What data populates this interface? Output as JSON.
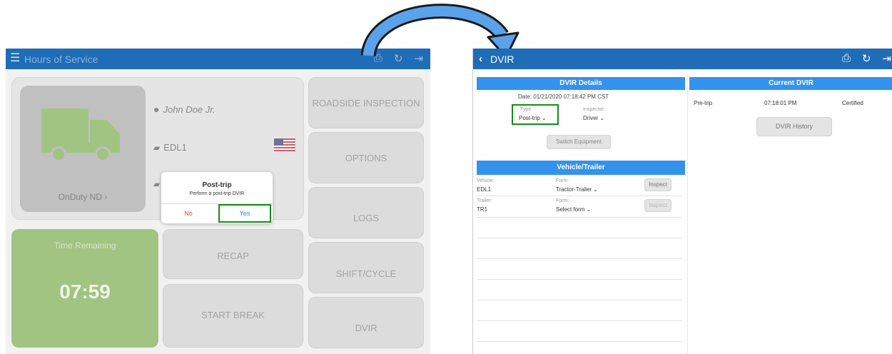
{
  "left_screen": {
    "header": {
      "title": "Hours of Service",
      "menu_icon": "hamburger-icon",
      "icons": [
        "print-icon",
        "refresh-icon",
        "logout-icon"
      ]
    },
    "driver": {
      "name": "John Doe Jr.",
      "vehicle": "EDL1",
      "duty_status": "OnDuty ND ›"
    },
    "tiles": {
      "roadside": "ROADSIDE INSPECTION",
      "options": "OPTIONS",
      "logs": "LOGS",
      "shift": "SHIFT/CYCLE",
      "dvir": "DVIR",
      "recap": "RECAP",
      "start_break": "START BREAK"
    },
    "time": {
      "label": "Time Remaining",
      "value": "07:59"
    },
    "dialog": {
      "title": "Post-trip",
      "message": "Perform a post-trip DVIR",
      "no": "No",
      "yes": "Yes"
    }
  },
  "right_screen": {
    "header": {
      "back": "‹",
      "title": "DVIR",
      "icons": [
        "print-icon",
        "refresh-icon",
        "logout-icon"
      ]
    },
    "details": {
      "section": "DVIR Details",
      "date": "Date: 01/21/2020 07:18:42 PM CST",
      "type_label": "Type:",
      "type_value": "Post-trip ⌄",
      "inspector_label": "Inspector:",
      "inspector_value": "Driver ⌄",
      "switch_equipment": "Switch Equipment"
    },
    "vehicle_trailer": {
      "section": "Vehicle/Trailer",
      "rows": [
        {
          "label": "Vehicle:",
          "value": "EDL1",
          "form_label": "Form:",
          "form_value": "Tractor-Trailer ⌄",
          "button": "Inspect"
        },
        {
          "label": "Trailer:",
          "value": "TR1",
          "form_label": "Form:",
          "form_value": "Select form ⌄",
          "button": "Inspect"
        }
      ]
    },
    "current": {
      "section": "Current DVIR",
      "row": {
        "type": "Pre-trip",
        "time": "07:18:01 PM",
        "status": "Certified"
      },
      "history_button": "DVIR History"
    }
  },
  "colors": {
    "header": "#1f6db7",
    "section": "#3492ee",
    "highlight": "#168a1a",
    "time_tile": "#7fae52"
  }
}
